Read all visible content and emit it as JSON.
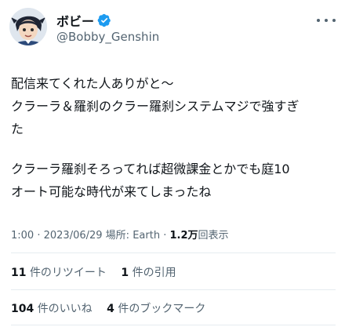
{
  "author": {
    "name": "ボビー",
    "handle": "@Bobby_Genshin",
    "verified_color": "#1d9bf0",
    "avatar_icon": "profile-photo"
  },
  "tweet": {
    "lines": [
      "配信来てくれた人ありがと〜",
      "クラーラ＆羅刹のクラー羅刹システムマジで強すぎ",
      "た",
      "",
      "クラーラ羅刹そろってれば超微課金とかでも庭10",
      "オート可能な時代が来てしまったね"
    ]
  },
  "meta": {
    "time": "1:00",
    "sep1": " · ",
    "date": "2023/06/29",
    "location": " 場所: Earth",
    "sep2": " · ",
    "views_count": "1.2万",
    "views_label": "回表示"
  },
  "stats_row1": {
    "retweets_count": "11",
    "retweets_label": "件のリツイート",
    "quotes_count": "1",
    "quotes_label": "件の引用"
  },
  "stats_row2": {
    "likes_count": "104",
    "likes_label": "件のいいね",
    "bookmarks_count": "4",
    "bookmarks_label": "件のブックマーク"
  }
}
